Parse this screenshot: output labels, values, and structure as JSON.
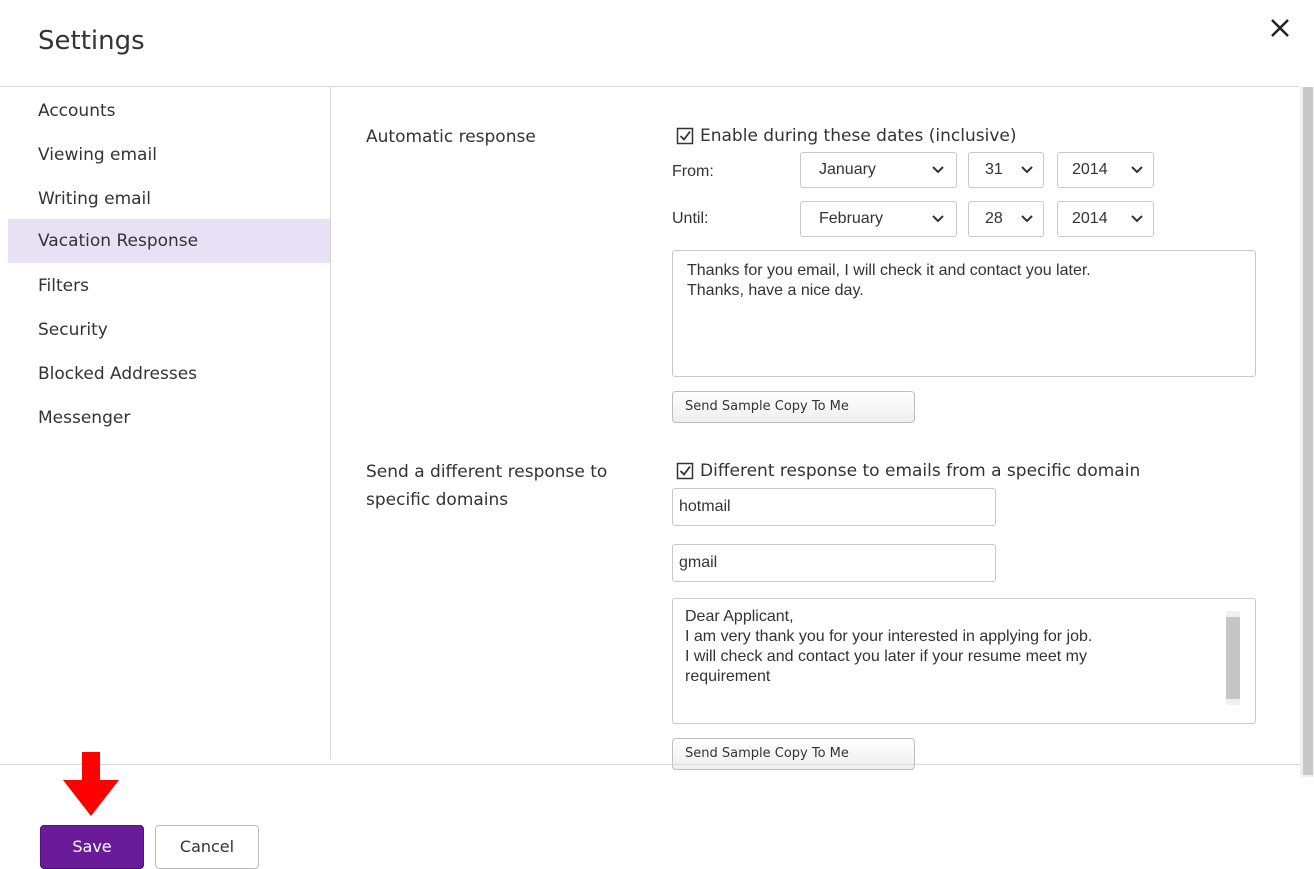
{
  "header": {
    "title": "Settings",
    "close_icon": "close-icon"
  },
  "sidebar": {
    "items": [
      {
        "label": "Accounts"
      },
      {
        "label": "Viewing email"
      },
      {
        "label": "Writing email"
      },
      {
        "label": "Vacation Response",
        "active": true
      },
      {
        "label": "Filters"
      },
      {
        "label": "Security"
      },
      {
        "label": "Blocked Addresses"
      },
      {
        "label": "Messenger"
      }
    ]
  },
  "auto_response": {
    "section_label": "Automatic response",
    "enable_label": "Enable during these dates (inclusive)",
    "enable_checked": true,
    "from_label": "From:",
    "from_month": "January",
    "from_day": "31",
    "from_year": "2014",
    "until_label": "Until:",
    "until_month": "February",
    "until_day": "28",
    "until_year": "2014",
    "message": "Thanks for you email, I will check it and contact you later.\nThanks, have a nice day.",
    "sample_button": "Send Sample Copy To Me"
  },
  "domain_response": {
    "section_label_line1": "Send a different response to",
    "section_label_line2": "specific domains",
    "enable_label": "Different response to emails from a specific domain",
    "enable_checked": true,
    "domain_1": "hotmail",
    "domain_2": "gmail",
    "message": "Dear Applicant,\nI am very thank you for your interested in applying for job.\nI will check and contact you later if your resume meet my\nrequirement",
    "sample_button": "Send Sample Copy To Me"
  },
  "footer": {
    "save_label": "Save",
    "cancel_label": "Cancel"
  },
  "colors": {
    "accent": "#6a1b9a",
    "active_nav": "#e8e0f4",
    "arrow": "#ff0000"
  }
}
